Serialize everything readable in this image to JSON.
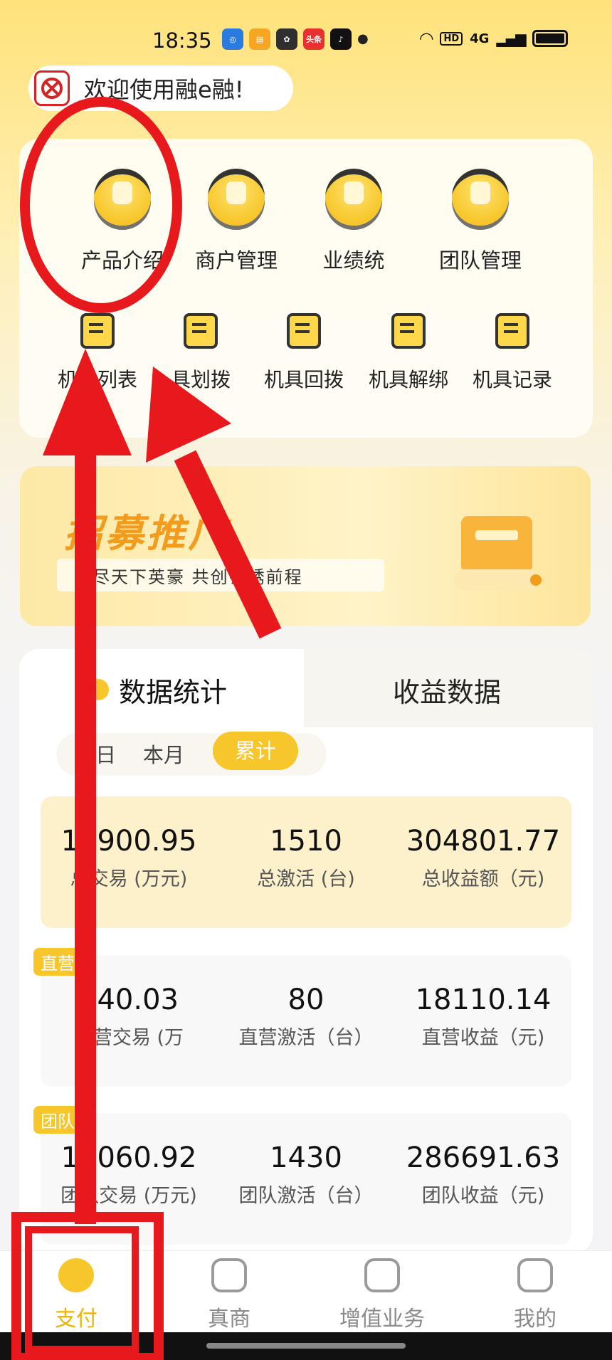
{
  "status_bar": {
    "time": "18:35",
    "app_icon_labels": [
      "头条"
    ],
    "network": "4G",
    "hd": "HD"
  },
  "welcome": {
    "text": "欢迎使用融e融!"
  },
  "quick_menu": {
    "primary": [
      {
        "label": "产品介绍",
        "icon": "product-intro-icon"
      },
      {
        "label": "商户管理",
        "icon": "merchant-icon"
      },
      {
        "label": "业绩统",
        "icon": "performance-icon"
      },
      {
        "label": "团队管理",
        "icon": "team-icon"
      }
    ],
    "secondary": [
      {
        "label": "机具列表",
        "icon": "device-list-icon"
      },
      {
        "label": "具划拨",
        "icon": "device-transfer-icon"
      },
      {
        "label": "机具回拨",
        "icon": "device-callback-icon"
      },
      {
        "label": "机具解绑",
        "icon": "device-unbind-icon"
      },
      {
        "label": "机具记录",
        "icon": "device-record-icon"
      }
    ]
  },
  "banner": {
    "title": "招募推广",
    "subtitle": "览尽天下英豪 共创锦绣前程"
  },
  "stats": {
    "tabs": {
      "active": "数据统计",
      "inactive": "收益数据"
    },
    "periods": [
      "今日",
      "本月",
      "累计"
    ],
    "active_period": "累计",
    "total": {
      "metrics": [
        {
          "value": "17900.95",
          "label": "总交易 (万元)"
        },
        {
          "value": "1510",
          "label": "总激活 (台)"
        },
        {
          "value": "304801.77",
          "label": "总收益额（元)"
        }
      ]
    },
    "direct": {
      "tag": "直营",
      "metrics": [
        {
          "value": "840.03",
          "label": "直营交易 (万"
        },
        {
          "value": "80",
          "label": "直营激活（台）"
        },
        {
          "value": "18110.14",
          "label": "直营收益（元)"
        }
      ]
    },
    "team": {
      "tag": "团队",
      "metrics": [
        {
          "value": "17060.92",
          "label": "团队交易 (万元)"
        },
        {
          "value": "1430",
          "label": "团队激活（台）"
        },
        {
          "value": "286691.63",
          "label": "团队收益（元)"
        }
      ]
    }
  },
  "bottom_nav": {
    "items": [
      {
        "label": "支付",
        "icon": "pay-icon",
        "active": true
      },
      {
        "label": "真商",
        "icon": "store-icon",
        "active": false
      },
      {
        "label": "增值业务",
        "icon": "chart-icon",
        "active": false
      },
      {
        "label": "我的",
        "icon": "profile-icon",
        "active": false
      }
    ]
  },
  "colors": {
    "accent": "#f7c62a",
    "annotation": "#e8191d"
  }
}
